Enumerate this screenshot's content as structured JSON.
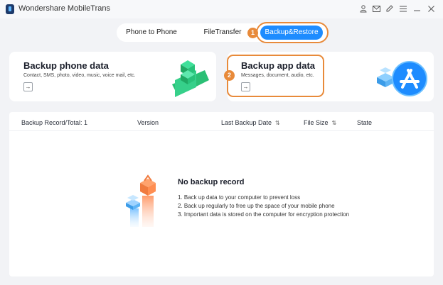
{
  "window": {
    "title": "Wondershare MobileTrans",
    "controls": [
      "user-icon",
      "mail-icon",
      "edit-icon",
      "menu-icon",
      "minimize-icon",
      "close-icon"
    ]
  },
  "tabs": [
    {
      "label": "Phone to Phone",
      "selected": false
    },
    {
      "label": "FileTransfer",
      "selected": false
    },
    {
      "label": "Backup&Restore",
      "selected": true
    }
  ],
  "steps": {
    "tab_badge": "1",
    "card_badge": "2"
  },
  "cards": {
    "backup_phone": {
      "title": "Backup phone data",
      "subtitle": "Contact, SMS, photo, video, music, voice mail, etc.",
      "arrow": "→"
    },
    "backup_app": {
      "title": "Backup app data",
      "subtitle": "Messages, document, audio, etc.",
      "arrow": "→"
    }
  },
  "table": {
    "headers": {
      "record": "Backup Record/Total: 1",
      "version": "Version",
      "last_backup_date": "Last Backup Date",
      "file_size": "File Size",
      "state": "State"
    }
  },
  "empty_state": {
    "title": "No backup record",
    "lines": [
      "1. Back up data to your computer to prevent loss",
      "2. Back up regularly to free up the space of your mobile phone",
      "3. Important data is stored on the computer for encryption protection"
    ]
  },
  "colors": {
    "accent": "#1e8cff",
    "highlight": "#e88a3a",
    "green": "#2bbf75"
  }
}
